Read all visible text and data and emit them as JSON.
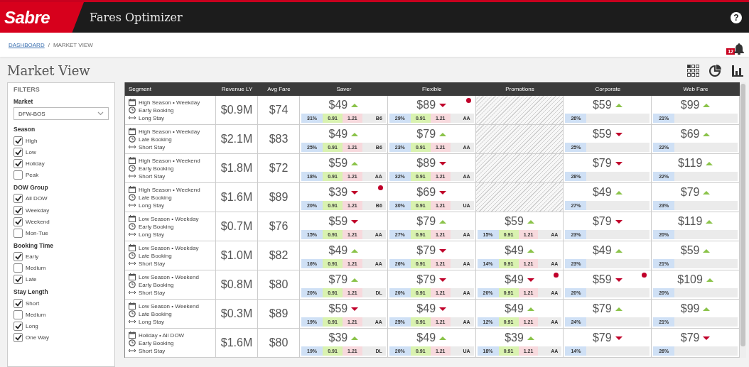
{
  "app": {
    "logo": "Sabre",
    "title": "Fares Optimizer",
    "help": "?"
  },
  "breadcrumb": [
    {
      "label": "DASHBOARD",
      "kind": "link"
    },
    {
      "label": "/",
      "kind": "separator"
    },
    {
      "label": "MARKET VIEW",
      "kind": "current"
    }
  ],
  "notifications": {
    "count": "12"
  },
  "page_title": "Market View",
  "filters": {
    "title": "FILTERS",
    "market": {
      "label": "Market",
      "value": "DFW-BOS"
    },
    "groups": [
      {
        "title": "Season",
        "options": [
          {
            "label": "High",
            "checked": true
          },
          {
            "label": "Low",
            "checked": true
          },
          {
            "label": "Holiday",
            "checked": true
          },
          {
            "label": "Peak",
            "checked": false
          }
        ]
      },
      {
        "title": "DOW Group",
        "options": [
          {
            "label": "All DOW",
            "checked": true
          },
          {
            "label": "Weekday",
            "checked": true
          },
          {
            "label": "Weekend",
            "checked": true
          },
          {
            "label": "Mon-Tue",
            "checked": false
          }
        ]
      },
      {
        "title": "Booking Time",
        "options": [
          {
            "label": "Early",
            "checked": true
          },
          {
            "label": "Medium",
            "checked": false
          },
          {
            "label": "Late",
            "checked": true
          }
        ]
      },
      {
        "title": "Stay Length",
        "options": [
          {
            "label": "Short",
            "checked": true
          },
          {
            "label": "Medium",
            "checked": false
          },
          {
            "label": "Long",
            "checked": true
          },
          {
            "label": "One Way",
            "checked": true
          }
        ]
      }
    ]
  },
  "table": {
    "columns": [
      "Segment",
      "Revenue LY",
      "Avg Fare",
      "Saver",
      "Flexible",
      "Promotions",
      "Corporate",
      "Web Fare"
    ],
    "rows": [
      {
        "segment": [
          "High Season • Weekday",
          "Early Booking",
          "Long Stay"
        ],
        "revenue": "$0.9M",
        "avg_fare": "$74",
        "fares": [
          {
            "kind": "full",
            "price": "$49",
            "rising": true,
            "alert": false,
            "share": "31%",
            "low": "0.91",
            "high": "1.21",
            "carrier": "B6"
          },
          {
            "kind": "full",
            "price": "$89",
            "rising": false,
            "alert": true,
            "share": "29%",
            "low": "0.91",
            "high": "1.21",
            "carrier": "AA"
          },
          {
            "kind": "unavailable"
          },
          {
            "kind": "share",
            "price": "$59",
            "rising": true,
            "alert": false,
            "share": "26%"
          },
          {
            "kind": "share",
            "price": "$99",
            "rising": true,
            "alert": false,
            "share": "21%"
          }
        ]
      },
      {
        "segment": [
          "High Season • Weekday",
          "Late Booking",
          "Short Stay"
        ],
        "revenue": "$2.1M",
        "avg_fare": "$83",
        "fares": [
          {
            "kind": "full",
            "price": "$49",
            "rising": true,
            "alert": false,
            "share": "25%",
            "low": "0.91",
            "high": "1.21",
            "carrier": "B6"
          },
          {
            "kind": "full",
            "price": "$79",
            "rising": true,
            "alert": false,
            "share": "23%",
            "low": "0.91",
            "high": "1.21",
            "carrier": "AA"
          },
          {
            "kind": "unavailable"
          },
          {
            "kind": "share",
            "price": "$59",
            "rising": false,
            "alert": false,
            "share": "25%"
          },
          {
            "kind": "share",
            "price": "$69",
            "rising": true,
            "alert": false,
            "share": "22%"
          }
        ]
      },
      {
        "segment": [
          "High Season • Weekend",
          "Early Booking",
          "Short Stay"
        ],
        "revenue": "$1.8M",
        "avg_fare": "$72",
        "fares": [
          {
            "kind": "full",
            "price": "$59",
            "rising": true,
            "alert": false,
            "share": "18%",
            "low": "0.91",
            "high": "1.21",
            "carrier": "AA"
          },
          {
            "kind": "full",
            "price": "$89",
            "rising": false,
            "alert": false,
            "share": "32%",
            "low": "0.91",
            "high": "1.21",
            "carrier": "AA"
          },
          {
            "kind": "unavailable"
          },
          {
            "kind": "share",
            "price": "$79",
            "rising": false,
            "alert": false,
            "share": "28%"
          },
          {
            "kind": "share",
            "price": "$119",
            "rising": true,
            "alert": false,
            "share": "22%"
          }
        ]
      },
      {
        "segment": [
          "High Season • Weekend",
          "Late Booking",
          "Long Stay"
        ],
        "revenue": "$1.6M",
        "avg_fare": "$89",
        "fares": [
          {
            "kind": "full",
            "price": "$39",
            "rising": false,
            "alert": true,
            "share": "20%",
            "low": "0.91",
            "high": "1.21",
            "carrier": "B6"
          },
          {
            "kind": "full",
            "price": "$69",
            "rising": false,
            "alert": false,
            "share": "30%",
            "low": "0.91",
            "high": "1.21",
            "carrier": "UA"
          },
          {
            "kind": "unavailable"
          },
          {
            "kind": "share",
            "price": "$49",
            "rising": true,
            "alert": false,
            "share": "27%"
          },
          {
            "kind": "share",
            "price": "$79",
            "rising": true,
            "alert": false,
            "share": "23%"
          }
        ]
      },
      {
        "segment": [
          "Low Season • Weekday",
          "Early Booking",
          "Long Stay"
        ],
        "revenue": "$0.7M",
        "avg_fare": "$76",
        "fares": [
          {
            "kind": "full",
            "price": "$59",
            "rising": false,
            "alert": false,
            "share": "15%",
            "low": "0.91",
            "high": "1.21",
            "carrier": "AA"
          },
          {
            "kind": "full",
            "price": "$79",
            "rising": true,
            "alert": false,
            "share": "27%",
            "low": "0.91",
            "high": "1.21",
            "carrier": "AA"
          },
          {
            "kind": "full",
            "price": "$59",
            "rising": true,
            "alert": false,
            "share": "15%",
            "low": "0.91",
            "high": "1.21",
            "carrier": "AA"
          },
          {
            "kind": "share",
            "price": "$79",
            "rising": false,
            "alert": false,
            "share": "23%"
          },
          {
            "kind": "share",
            "price": "$119",
            "rising": true,
            "alert": false,
            "share": "20%"
          }
        ]
      },
      {
        "segment": [
          "Low Season • Weekday",
          "Late Booking",
          "Short Stay"
        ],
        "revenue": "$1.0M",
        "avg_fare": "$82",
        "fares": [
          {
            "kind": "full",
            "price": "$49",
            "rising": true,
            "alert": false,
            "share": "16%",
            "low": "0.91",
            "high": "1.21",
            "carrier": "AA"
          },
          {
            "kind": "full",
            "price": "$79",
            "rising": false,
            "alert": false,
            "share": "26%",
            "low": "0.91",
            "high": "1.21",
            "carrier": "AA"
          },
          {
            "kind": "full",
            "price": "$49",
            "rising": true,
            "alert": false,
            "share": "14%",
            "low": "0.91",
            "high": "1.21",
            "carrier": "AA"
          },
          {
            "kind": "share",
            "price": "$49",
            "rising": true,
            "alert": false,
            "share": "23%"
          },
          {
            "kind": "share",
            "price": "$59",
            "rising": true,
            "alert": false,
            "share": "21%"
          }
        ]
      },
      {
        "segment": [
          "Low Season • Weekend",
          "Early Booking",
          "Short Stay"
        ],
        "revenue": "$0.8M",
        "avg_fare": "$80",
        "fares": [
          {
            "kind": "full",
            "price": "$79",
            "rising": true,
            "alert": false,
            "share": "20%",
            "low": "0.91",
            "high": "1.21",
            "carrier": "DL"
          },
          {
            "kind": "full",
            "price": "$79",
            "rising": false,
            "alert": false,
            "share": "20%",
            "low": "0.91",
            "high": "1.21",
            "carrier": "AA"
          },
          {
            "kind": "full",
            "price": "$49",
            "rising": false,
            "alert": true,
            "share": "20%",
            "low": "0.91",
            "high": "1.21",
            "carrier": "AA"
          },
          {
            "kind": "share",
            "price": "$59",
            "rising": false,
            "alert": true,
            "share": "20%"
          },
          {
            "kind": "share",
            "price": "$109",
            "rising": true,
            "alert": false,
            "share": "20%"
          }
        ]
      },
      {
        "segment": [
          "Low Season • Weekend",
          "Late Booking",
          "Long Stay"
        ],
        "revenue": "$0.3M",
        "avg_fare": "$89",
        "fares": [
          {
            "kind": "full",
            "price": "$59",
            "rising": false,
            "alert": false,
            "share": "19%",
            "low": "0.91",
            "high": "1.21",
            "carrier": "AA"
          },
          {
            "kind": "full",
            "price": "$49",
            "rising": false,
            "alert": false,
            "share": "25%",
            "low": "0.91",
            "high": "1.21",
            "carrier": "AA"
          },
          {
            "kind": "full",
            "price": "$49",
            "rising": true,
            "alert": false,
            "share": "12%",
            "low": "0.91",
            "high": "1.21",
            "carrier": "AA"
          },
          {
            "kind": "share",
            "price": "$79",
            "rising": true,
            "alert": false,
            "share": "24%"
          },
          {
            "kind": "share",
            "price": "$99",
            "rising": true,
            "alert": false,
            "share": "21%"
          }
        ]
      },
      {
        "segment": [
          "Holiday • All DOW",
          "Early Booking",
          "Short Stay"
        ],
        "revenue": "$1.6M",
        "avg_fare": "$80",
        "fares": [
          {
            "kind": "full",
            "price": "$39",
            "rising": true,
            "alert": false,
            "share": "19%",
            "low": "0.91",
            "high": "1.21",
            "carrier": "DL"
          },
          {
            "kind": "full",
            "price": "$49",
            "rising": true,
            "alert": false,
            "share": "20%",
            "low": "0.91",
            "high": "1.21",
            "carrier": "UA"
          },
          {
            "kind": "full",
            "price": "$39",
            "rising": true,
            "alert": false,
            "share": "18%",
            "low": "0.91",
            "high": "1.21",
            "carrier": "AA"
          },
          {
            "kind": "share",
            "price": "$79",
            "rising": false,
            "alert": false,
            "share": "14%"
          },
          {
            "kind": "share",
            "price": "$79",
            "rising": false,
            "alert": false,
            "share": "26%"
          }
        ]
      }
    ]
  }
}
